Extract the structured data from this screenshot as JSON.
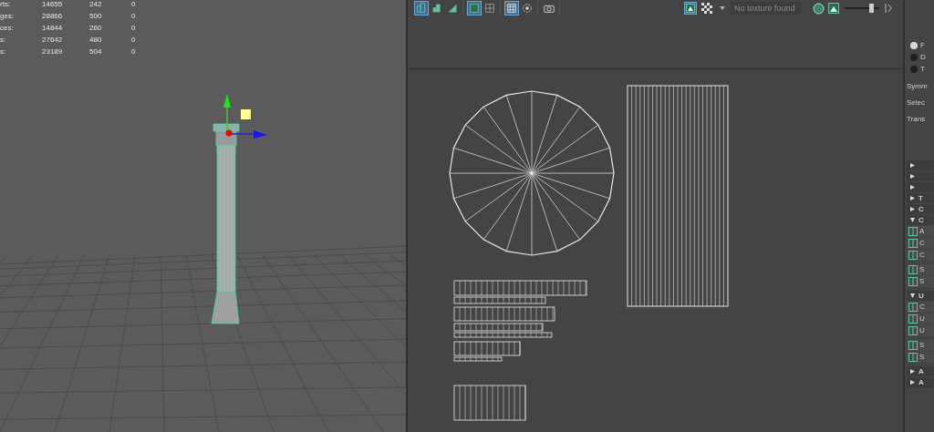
{
  "hud": {
    "rows": [
      {
        "label": "rts:",
        "values": [
          "14655",
          "242",
          "0"
        ]
      },
      {
        "label": "ges:",
        "values": [
          "28866",
          "500",
          "0"
        ]
      },
      {
        "label": "ces:",
        "values": [
          "14844",
          "260",
          "0"
        ]
      },
      {
        "label": "s:",
        "values": [
          "27642",
          "480",
          "0"
        ]
      },
      {
        "label": "s:",
        "values": [
          "23189",
          "504",
          "0"
        ]
      }
    ]
  },
  "uv_toolbar": {
    "tools": [
      {
        "selected": true
      },
      {
        "selected": false
      },
      {
        "selected": false
      },
      {
        "selected": true
      },
      {
        "selected": false
      },
      {
        "selected": true
      },
      {
        "selected": false
      },
      {
        "selected": false
      }
    ],
    "image_toggle": {
      "selected": true
    },
    "texture_field": {
      "placeholder": "No texture found"
    },
    "exposure_slider": {
      "level": 0.78
    }
  },
  "right_panel": {
    "radio_options": [
      {
        "label": "F",
        "selected": true
      },
      {
        "label": "D",
        "selected": false
      },
      {
        "label": "T",
        "selected": false
      }
    ],
    "fields": [
      "Symm",
      "Selec",
      "Trans"
    ],
    "sections": [
      {
        "expanded": false
      },
      {
        "expanded": false
      },
      {
        "expanded": false
      },
      {
        "label": "T",
        "expanded": false
      },
      {
        "label": "C",
        "expanded": false
      },
      {
        "label": "C",
        "expanded": true,
        "items": [
          "A",
          "C",
          "C",
          "S",
          "S"
        ]
      },
      {
        "label": "U",
        "expanded": true,
        "items": [
          "C",
          "U",
          "U",
          "S",
          "S"
        ]
      },
      {
        "label": "A",
        "expanded": false
      },
      {
        "label": "A",
        "expanded": false
      }
    ]
  }
}
